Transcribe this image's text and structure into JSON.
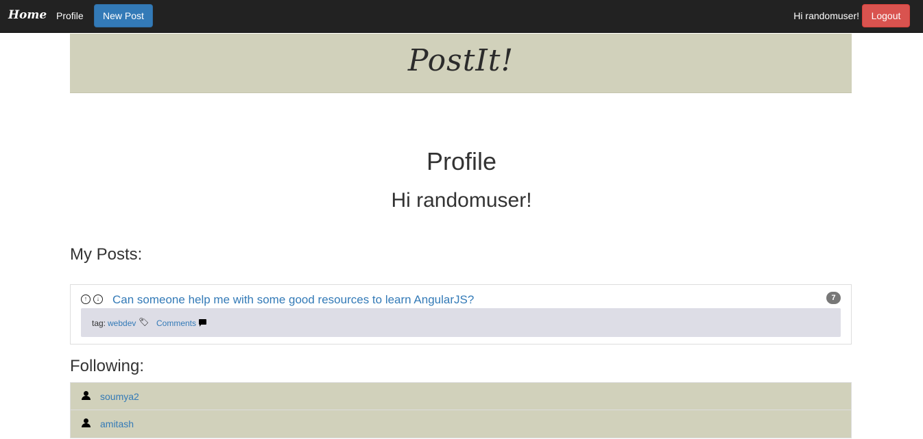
{
  "navbar": {
    "brand": "Home",
    "profile_link": "Profile",
    "new_post_button": "New Post",
    "greeting": "Hi randomuser!",
    "logout_button": "Logout"
  },
  "banner": {
    "title": "PostIt!"
  },
  "main": {
    "heading": "Profile",
    "subheading": "Hi randomuser!",
    "my_posts_heading": "My Posts:",
    "following_heading": "Following:"
  },
  "posts": [
    {
      "title": "Can someone help me with some good resources to learn AngularJS?",
      "count": "7",
      "tag_label": "tag:",
      "tag": "webdev",
      "comments_label": "Comments"
    }
  ],
  "following": [
    {
      "name": "soumya2"
    },
    {
      "name": "amitash"
    }
  ],
  "colors": {
    "navbar_bg": "#222222",
    "banner_bg": "#d1d1bb",
    "primary": "#337ab7",
    "danger": "#d9534f",
    "meta_bg": "#dddde6",
    "badge_bg": "#777777"
  },
  "icons": {
    "vote_up": "circle-arrow-up-icon",
    "vote_down": "circle-arrow-down-icon",
    "tag": "tag-icon",
    "comment": "comment-icon",
    "user": "user-icon"
  }
}
